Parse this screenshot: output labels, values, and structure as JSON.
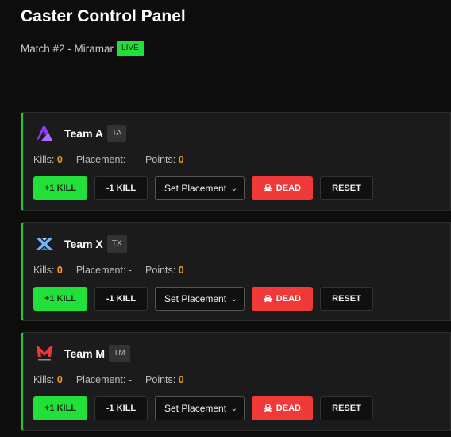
{
  "header": {
    "title": "Caster Control Panel",
    "match": "Match #2 - Miramar",
    "status_badge": "LIVE"
  },
  "colors": {
    "accent_green": "#22e03a",
    "danger_red": "#f03a3a",
    "stat_orange": "#f39a2a",
    "divider_orange": "#c8802a"
  },
  "labels": {
    "kills": "Kills:",
    "placement": "Placement:",
    "points": "Points:",
    "add_kill": "+1 KILL",
    "remove_kill": "-1 KILL",
    "set_placement": "Set Placement",
    "dead": "DEAD",
    "reset": "RESET"
  },
  "teams": [
    {
      "name": "Team A",
      "tag": "TA",
      "logo_icon": "team-a-logo-icon",
      "kills": "0",
      "placement": "-",
      "points": "0"
    },
    {
      "name": "Team X",
      "tag": "TX",
      "logo_icon": "team-x-logo-icon",
      "kills": "0",
      "placement": "-",
      "points": "0"
    },
    {
      "name": "Team M",
      "tag": "TM",
      "logo_icon": "team-m-logo-icon",
      "kills": "0",
      "placement": "-",
      "points": "0"
    }
  ]
}
